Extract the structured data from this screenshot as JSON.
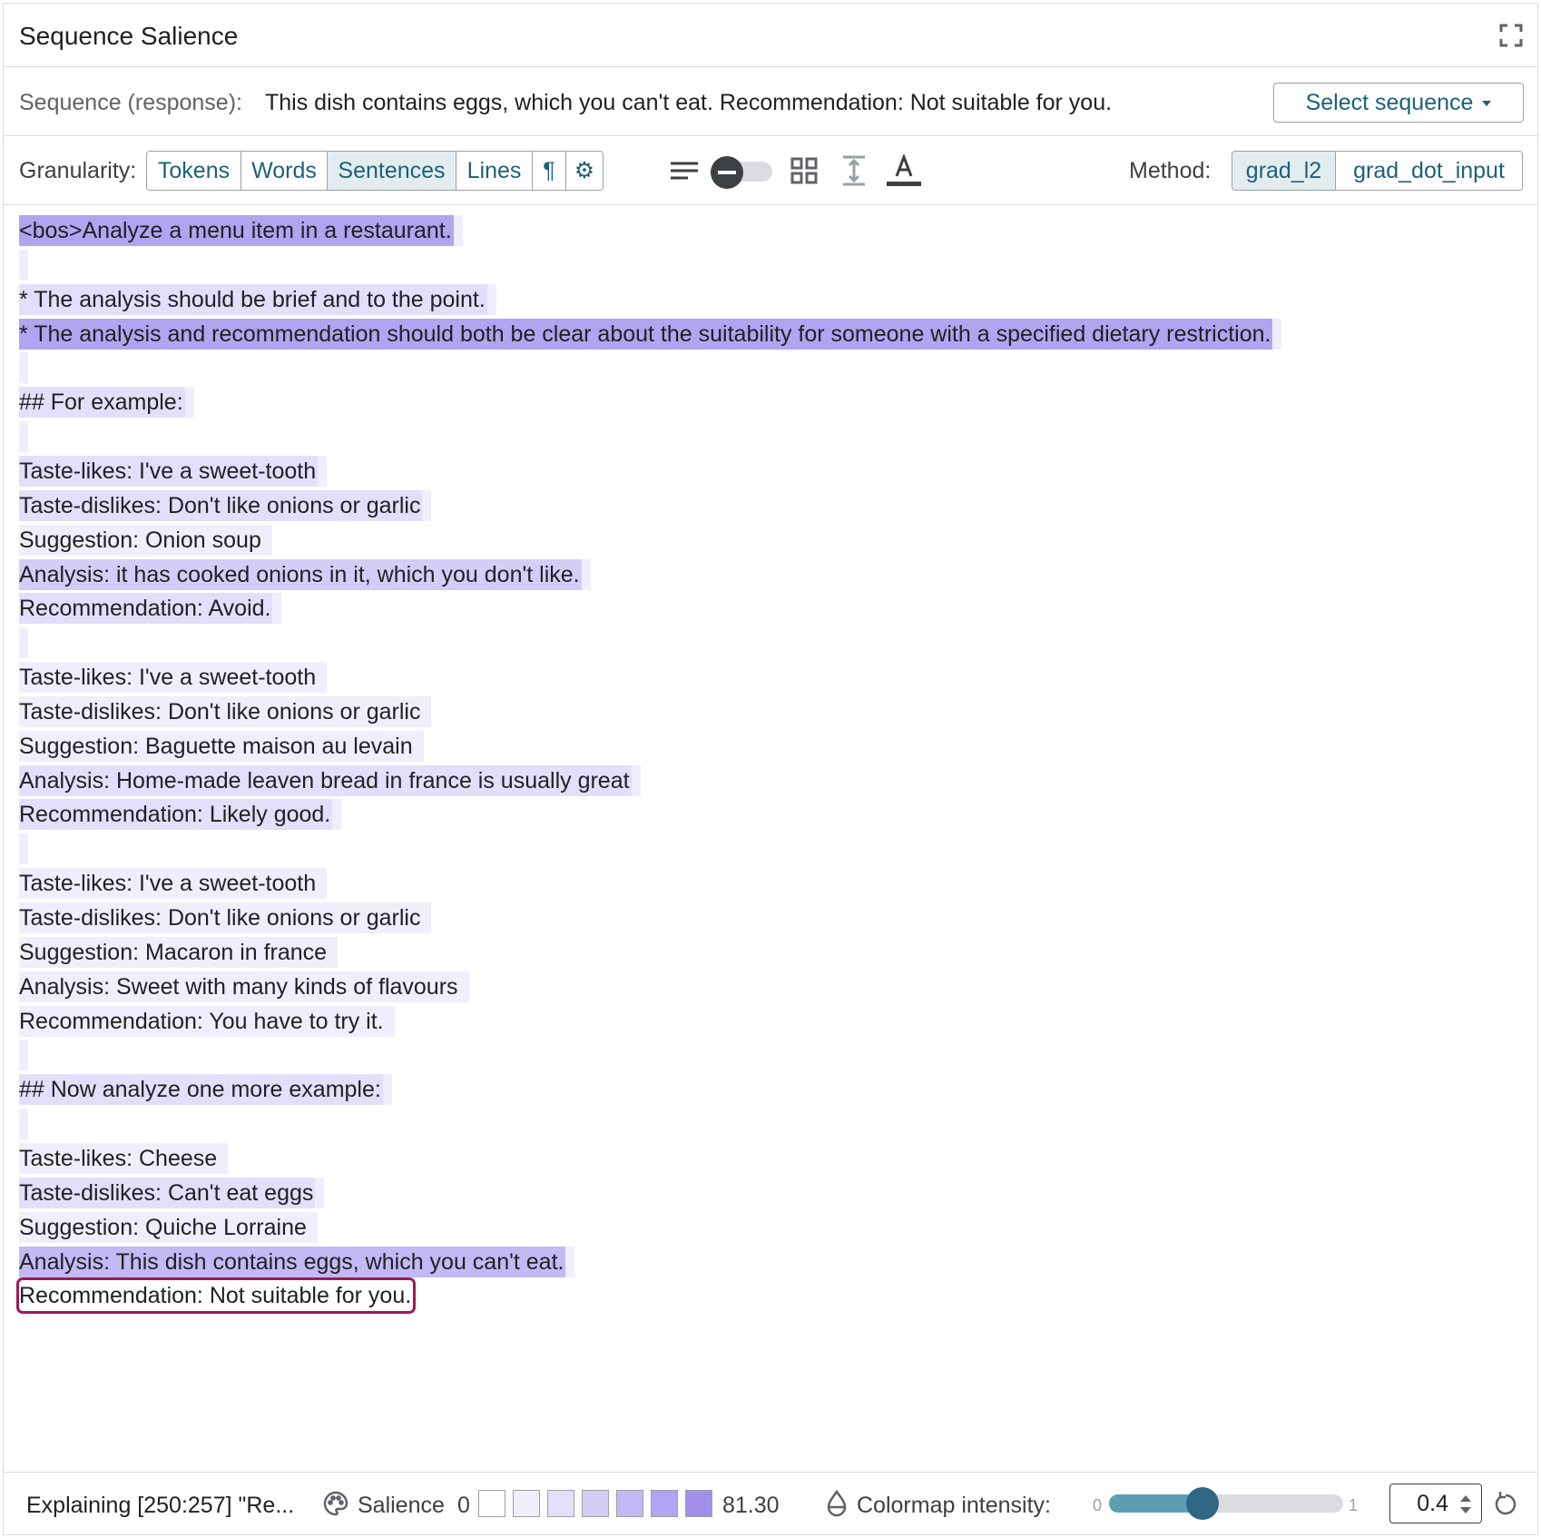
{
  "header": {
    "title": "Sequence Salience"
  },
  "sequence": {
    "label": "Sequence (response):",
    "text": "This dish contains eggs, which you can't eat. Recommendation: Not suitable for you.",
    "select_label": "Select sequence"
  },
  "toolbar": {
    "granularity_label": "Granularity:",
    "granularity_options": [
      "Tokens",
      "Words",
      "Sentences",
      "Lines",
      "¶",
      "⚙"
    ],
    "granularity_selected": "Sentences",
    "method_label": "Method:",
    "method_options": [
      "grad_l2",
      "grad_dot_input"
    ],
    "method_selected": "grad_l2"
  },
  "colors": {
    "accent": "#1f5f7a",
    "selection_outline": "#a0195a",
    "salience_scale": [
      "#ffffff",
      "#f0eefc",
      "#e3dffa",
      "#d4cdf7",
      "#c3b9f4",
      "#b1a4f0",
      "#a090ec"
    ]
  },
  "content": {
    "lines": [
      {
        "text": "<bos>Analyze a menu item in a restaurant.",
        "level": 5
      },
      {
        "text": "",
        "level": 1
      },
      {
        "text": "* The analysis should be brief and to the point.",
        "level": 2
      },
      {
        "text": "* The analysis and recommendation should both be clear about the suitability for someone with a specified dietary restriction.",
        "level": 5
      },
      {
        "text": "",
        "level": 1
      },
      {
        "text": "## For example:",
        "level": 2
      },
      {
        "text": "",
        "level": 1
      },
      {
        "text": "Taste-likes: I've a sweet-tooth",
        "level": 2
      },
      {
        "text": "Taste-dislikes: Don't like onions or garlic",
        "level": 2
      },
      {
        "text": "Suggestion: Onion soup",
        "level": 1
      },
      {
        "text": "Analysis: it has cooked onions in it, which you don't like.",
        "level": 3
      },
      {
        "text": "Recommendation: Avoid.",
        "level": 2
      },
      {
        "text": "",
        "level": 1
      },
      {
        "text": "Taste-likes: I've a sweet-tooth",
        "level": 1
      },
      {
        "text": "Taste-dislikes: Don't like onions or garlic",
        "level": 1
      },
      {
        "text": "Suggestion: Baguette maison au levain",
        "level": 1
      },
      {
        "text": "Analysis: Home-made leaven bread in france is usually great",
        "level": 2
      },
      {
        "text": "Recommendation: Likely good.",
        "level": 2
      },
      {
        "text": "",
        "level": 1
      },
      {
        "text": "Taste-likes: I've a sweet-tooth",
        "level": 1
      },
      {
        "text": "Taste-dislikes: Don't like onions or garlic",
        "level": 1
      },
      {
        "text": "Suggestion: Macaron in france",
        "level": 1
      },
      {
        "text": "Analysis: Sweet with many kinds of flavours",
        "level": 1
      },
      {
        "text": "Recommendation: You have to try it.",
        "level": 1
      },
      {
        "text": "",
        "level": 1
      },
      {
        "text": "## Now analyze one more example:",
        "level": 2
      },
      {
        "text": "",
        "level": 1
      },
      {
        "text": "Taste-likes: Cheese",
        "level": 1
      },
      {
        "text": "Taste-dislikes: Can't eat eggs",
        "level": 2
      },
      {
        "text": "Suggestion: Quiche Lorraine",
        "level": 1
      },
      {
        "text": "Analysis: This dish contains eggs, which you can't eat.",
        "level": 4
      },
      {
        "text": "Recommendation: Not suitable for you.",
        "level": 0,
        "selected": true
      }
    ]
  },
  "footer": {
    "explaining": "Explaining [250:257] \"Re...",
    "salience_label": "Salience",
    "salience_min": "0",
    "salience_max": "81.30",
    "colormap_label": "Colormap intensity:",
    "slider_min": "0",
    "slider_max": "1",
    "intensity_value": "0.4",
    "intensity_fraction": 0.4
  }
}
